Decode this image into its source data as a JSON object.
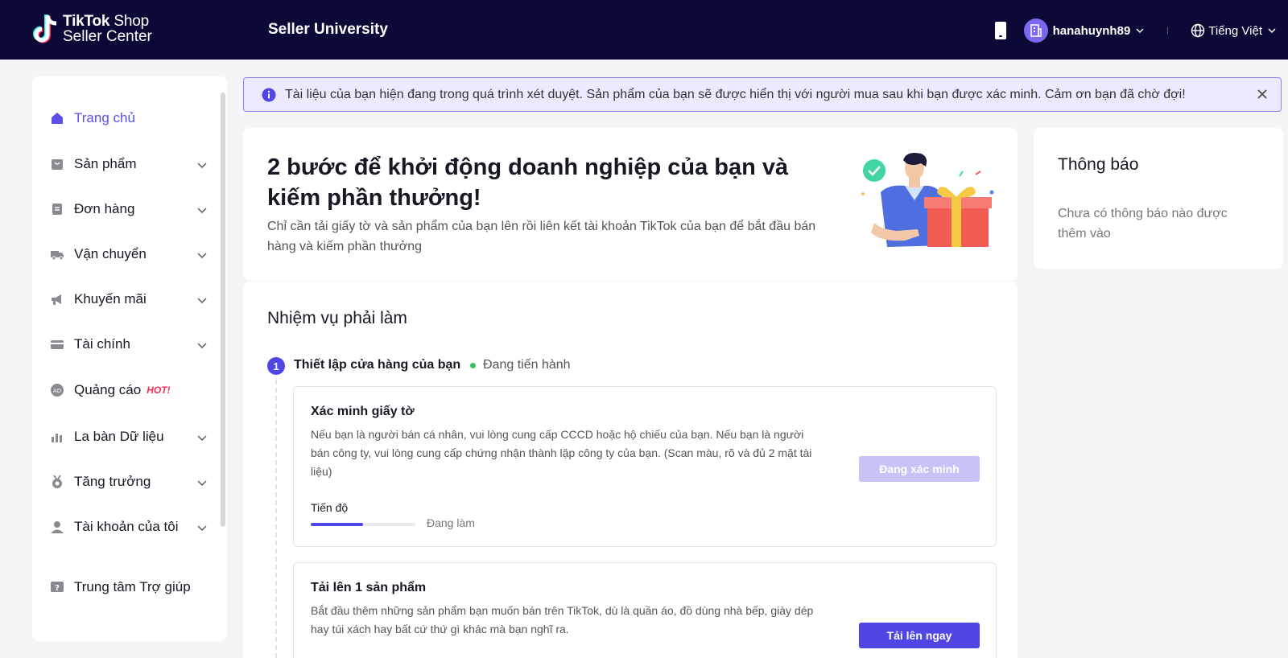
{
  "brand": {
    "logo_line1_bold": "TikTok",
    "logo_line1_rest": "Shop",
    "logo_line2": "Seller Center"
  },
  "header": {
    "title": "Seller University",
    "username": "hanahuynh89",
    "language": "Tiếng Việt"
  },
  "sidebar": {
    "items": [
      {
        "label": "Trang chủ",
        "icon": "home-icon",
        "active": true
      },
      {
        "label": "Sản phẩm",
        "icon": "product-bag-icon"
      },
      {
        "label": "Đơn hàng",
        "icon": "order-document-icon"
      },
      {
        "label": "Vận chuyển",
        "icon": "truck-icon"
      },
      {
        "label": "Khuyến mãi",
        "icon": "megaphone-icon"
      },
      {
        "label": "Tài chính",
        "icon": "credit-card-icon"
      },
      {
        "label": "Quảng cáo",
        "icon": "ad-icon",
        "badge": "HOT!"
      },
      {
        "label": "La bàn Dữ liệu",
        "icon": "bar-chart-icon"
      },
      {
        "label": "Tăng trưởng",
        "icon": "medal-icon"
      },
      {
        "label": "Tài khoản của tôi",
        "icon": "user-icon"
      },
      {
        "label": "Trung tâm Trợ giúp",
        "icon": "help-icon"
      }
    ]
  },
  "banner": {
    "text": "Tài liệu của bạn hiện đang trong quá trình xét duyệt. Sản phẩm của bạn sẽ được hiển thị với người mua sau khi bạn được xác minh. Cảm ơn bạn đã chờ đợi!"
  },
  "hero": {
    "title": "2 bước để khởi động doanh nghiệp của bạn và kiếm phần thưởng!",
    "subtitle": "Chỉ cần tải giấy tờ và sản phẩm của bạn lên rồi liên kết tài khoản TikTok của bạn để bắt đầu bán hàng và kiếm phần thưởng"
  },
  "tasks": {
    "title": "Nhiệm vụ phải làm",
    "step_number": "1",
    "step_label": "Thiết lập cửa hàng của bạn",
    "step_status": "Đang tiến hành",
    "verify": {
      "title": "Xác minh giấy tờ",
      "description": "Nếu bạn là người bán cá nhân, vui lòng cung cấp CCCD hoặc hộ chiếu của bạn. Nếu bạn là người bán công ty, vui lòng cung cấp chứng nhận thành lập công ty của bạn. (Scan màu, rõ và đủ 2 mặt tài liệu)",
      "button": "Đang xác minh",
      "progress_label": "Tiến độ",
      "progress_status": "Đang làm",
      "progress_fraction": 0.5
    },
    "upload": {
      "title": "Tải lên 1 sản phẩm",
      "description": "Bắt đầu thêm những sản phẩm bạn muốn bán trên TikTok, dù là quần áo, đồ dùng nhà bếp, giày dép hay túi xách hay bất cứ thứ gì khác mà bạn nghĩ ra.",
      "button": "Tải lên ngay"
    }
  },
  "notifications": {
    "title": "Thông báo",
    "empty": "Chưa có thông báo nào được thêm vào"
  },
  "colors": {
    "topbar": "#0b0a36",
    "accent": "#4f46e5",
    "active_nav": "#5a4fe8",
    "hot_badge": "#fe2c55",
    "status_green": "#36c25f"
  }
}
